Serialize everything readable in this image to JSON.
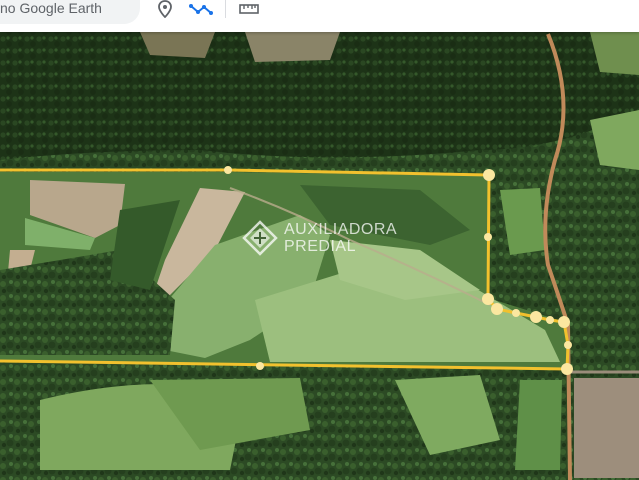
{
  "toolbar": {
    "search_text": "no Google Earth",
    "tools": [
      {
        "icon": "place-pin-icon",
        "color": "#5f6368"
      },
      {
        "icon": "path-line-icon",
        "color": "#1a73e8"
      },
      {
        "icon": "ruler-icon",
        "color": "#5f6368"
      }
    ]
  },
  "watermark": {
    "line1": "AUXILIADORA",
    "line2": "PREDIAL"
  },
  "measurement": {
    "outline_color": "#f2c12e",
    "vertex_color": "#fbe7a0"
  }
}
